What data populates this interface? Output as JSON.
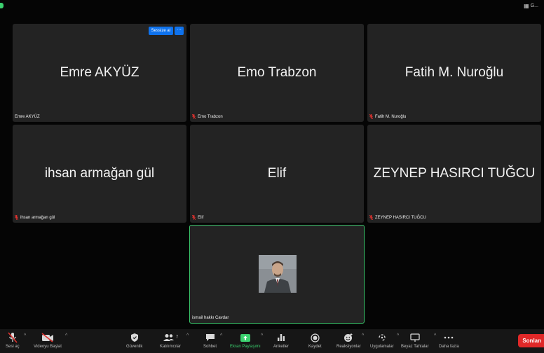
{
  "view_switch": {
    "label": "G..."
  },
  "hover_controls": {
    "mute_label": "Sessize al",
    "more_label": "···"
  },
  "participants": [
    {
      "display_name": "Emre AKYÜZ",
      "footer_name": "Emre AKYÜZ",
      "muted": false
    },
    {
      "display_name": "Emo Trabzon",
      "footer_name": "Emo Trabzon",
      "muted": true
    },
    {
      "display_name": "Fatih M. Nuroğlu",
      "footer_name": "Fatih M. Nuroğlu",
      "muted": true
    },
    {
      "display_name": "ihsan armağan gül",
      "footer_name": "ihsan armağan gül",
      "muted": true
    },
    {
      "display_name": "Elif",
      "footer_name": "Elif",
      "muted": true
    },
    {
      "display_name": "ZEYNEP HASIRCI TUĞCU",
      "footer_name": "ZEYNEP HASIRCI TUĞCU",
      "muted": true
    },
    {
      "display_name": "",
      "footer_name": "ismail hakkı Cavdar",
      "muted": false,
      "active_speaker": true
    }
  ],
  "toolbar": {
    "unmute": "Sesi aç",
    "start_video": "Videoyu Başlat",
    "security": "Güvenlik",
    "participants": "Katılımcılar",
    "participants_count": "7",
    "chat": "Sohbet",
    "share_screen": "Ekran Paylaşımı",
    "polls": "Anketler",
    "record": "Kaydet",
    "reactions": "Reaksiyonlar",
    "apps": "Uygulamalar",
    "whiteboards": "Beyaz Tahtalar",
    "more": "Daha fazla",
    "end": "Sonlan"
  },
  "colors": {
    "accent_blue": "#0e72ed",
    "active_green": "#3ac46a",
    "end_red": "#e02828",
    "muted_red": "#e0322f"
  }
}
